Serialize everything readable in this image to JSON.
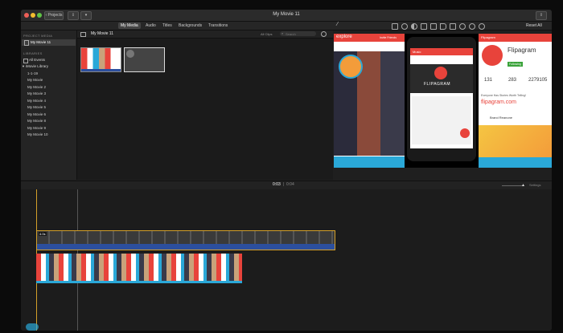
{
  "window": {
    "title": "My Movie 11"
  },
  "toolbar": {
    "projects_label": "Projects",
    "share_label": "",
    "tabs": [
      {
        "label": "My Media"
      },
      {
        "label": "Audio"
      },
      {
        "label": "Titles"
      },
      {
        "label": "Backgrounds"
      },
      {
        "label": "Transitions"
      }
    ],
    "reset_all_label": "Reset All"
  },
  "sidebar": {
    "project_media_header": "PROJECT MEDIA",
    "project_item": "My Movie 11",
    "libraries_header": "LIBRARIES",
    "all_events": "All Events",
    "library_name": "iMovie Library",
    "events": [
      "1-1-19",
      "My Movie",
      "My Movie 2",
      "My Movie 3",
      "My Movie 4",
      "My Movie 5",
      "My Movie 6",
      "My Movie 8",
      "My Movie 9",
      "My Movie 10"
    ]
  },
  "browser": {
    "title": "My Movie 11",
    "filter_label": "All Clips",
    "search_placeholder": "Search"
  },
  "viewer": {
    "left_screen": {
      "title": "explore",
      "link": "Invite Friends"
    },
    "center_phone": {
      "app_name": "FLIPAGRAM",
      "header": "Music"
    },
    "right_screen": {
      "header": "Flipagram",
      "profile_name": "Flipagram",
      "follow_label": "Following",
      "stats": [
        "131",
        "283",
        "2279105"
      ],
      "tagline": "Everyone Has Stories Worth Telling!",
      "site": "flipagram.com",
      "user": "Brand Reanone"
    }
  },
  "timeline": {
    "current_time": "0:03",
    "total_time": "0:04",
    "settings_label": "Settings",
    "clip_duration": "4.0s"
  },
  "colors": {
    "accent_red": "#e8433b",
    "clip_yellow": "#d4a02a",
    "audio_blue": "#2c4f9e",
    "viewer_blue": "#2aa8d8"
  }
}
